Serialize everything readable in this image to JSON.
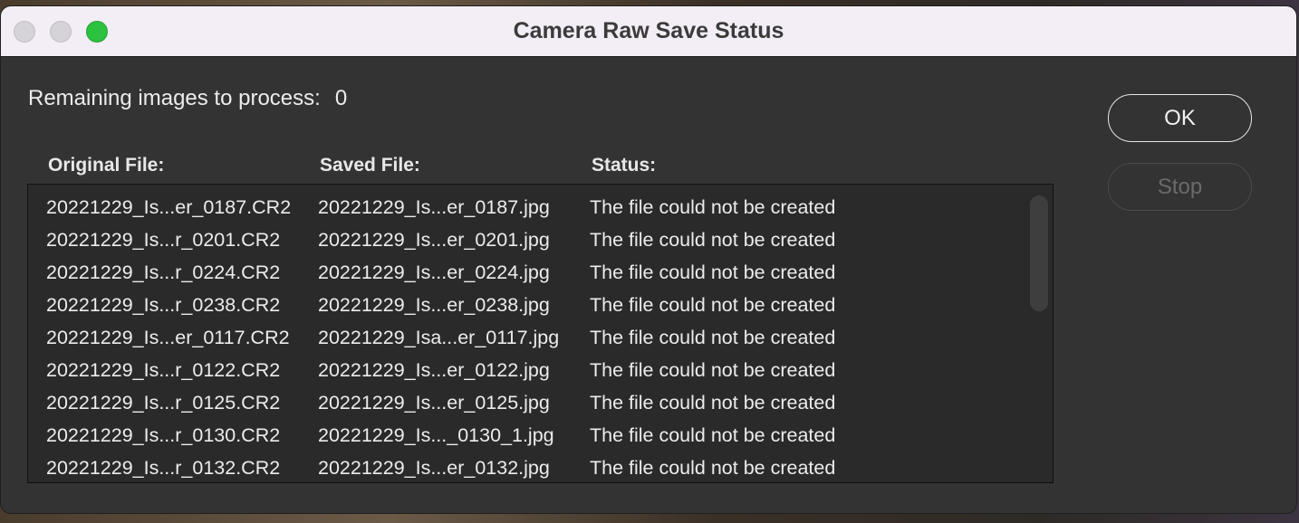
{
  "window": {
    "title": "Camera Raw Save Status"
  },
  "status": {
    "remaining_label": "Remaining images to process:",
    "remaining_count": "0"
  },
  "table": {
    "headers": {
      "original": "Original File:",
      "saved": "Saved File:",
      "status": "Status:"
    },
    "rows": [
      {
        "original": "20221229_Is...er_0187.CR2",
        "saved": "20221229_Is...er_0187.jpg",
        "status": "The file could not be created"
      },
      {
        "original": "20221229_Is...r_0201.CR2",
        "saved": "20221229_Is...er_0201.jpg",
        "status": "The file could not be created"
      },
      {
        "original": "20221229_Is...r_0224.CR2",
        "saved": "20221229_Is...er_0224.jpg",
        "status": "The file could not be created"
      },
      {
        "original": "20221229_Is...r_0238.CR2",
        "saved": "20221229_Is...er_0238.jpg",
        "status": "The file could not be created"
      },
      {
        "original": "20221229_Is...er_0117.CR2",
        "saved": "20221229_Isa...er_0117.jpg",
        "status": "The file could not be created"
      },
      {
        "original": "20221229_Is...r_0122.CR2",
        "saved": "20221229_Is...er_0122.jpg",
        "status": "The file could not be created"
      },
      {
        "original": "20221229_Is...r_0125.CR2",
        "saved": "20221229_Is...er_0125.jpg",
        "status": "The file could not be created"
      },
      {
        "original": "20221229_Is...r_0130.CR2",
        "saved": "20221229_Is..._0130_1.jpg",
        "status": "The file could not be created"
      },
      {
        "original": "20221229_Is...r_0132.CR2",
        "saved": "20221229_Is...er_0132.jpg",
        "status": "The file could not be created"
      }
    ]
  },
  "buttons": {
    "ok_label": "OK",
    "stop_label": "Stop",
    "stop_enabled": false
  },
  "colors": {
    "window_bg": "#333333",
    "titlebar_bg": "#f3eef5",
    "zoom_button": "#2cc13f",
    "text": "#ececec"
  }
}
